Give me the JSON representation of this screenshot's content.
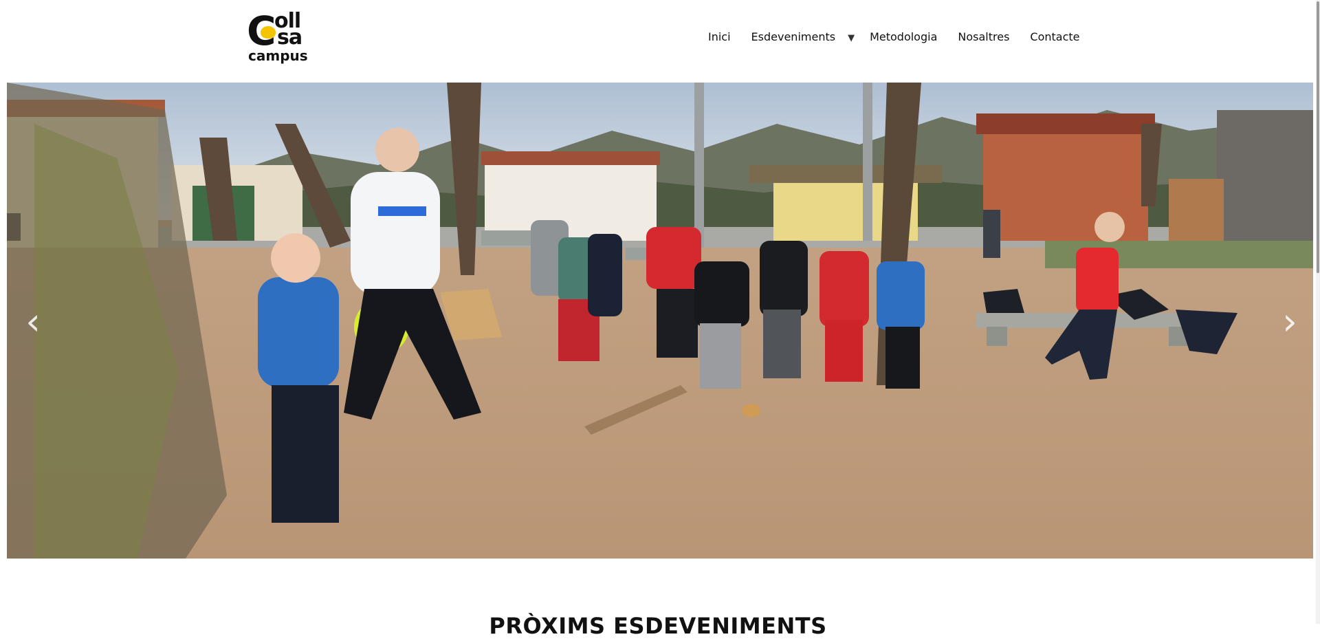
{
  "logo": {
    "line1": "oll",
    "line2": "sa",
    "line3": "campus",
    "mark": "C"
  },
  "nav": {
    "items": [
      {
        "label": "Inici"
      },
      {
        "label": "Esdeveniments",
        "has_dropdown": true
      },
      {
        "label": "Metodologia"
      },
      {
        "label": "Nosaltres"
      },
      {
        "label": "Contacte"
      }
    ],
    "dropdown_icon": "▼"
  },
  "hero": {
    "prev_icon": "‹",
    "next_icon": "›"
  },
  "events_section": {
    "title": "PRÒXIMS ESDEVENIMENTS"
  },
  "colors": {
    "accent": "#f5c400",
    "text": "#111111",
    "ground": "#c9a98a",
    "sky": "#c8d4e2"
  }
}
